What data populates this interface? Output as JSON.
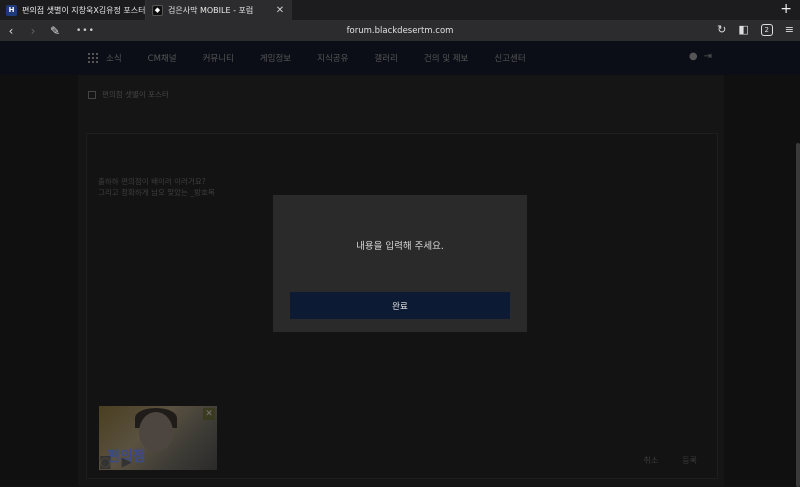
{
  "browser": {
    "tabs": [
      {
        "favicon": "H",
        "title": "편의점 샛별이 지창욱X김유정 포스터",
        "active": false
      },
      {
        "favicon": "◆",
        "title": "검은사막 MOBILE - 포럼",
        "active": true
      }
    ],
    "new_tab": "+",
    "close": "✕",
    "address": "forum.blackdesertm.com",
    "tab_count": "2"
  },
  "site_nav": {
    "menu": [
      "소식",
      "CM채널",
      "커뮤니티",
      "게임정보",
      "지식공유",
      "갤러리",
      "건의 및 제보",
      "신고센터"
    ]
  },
  "content": {
    "draft_label": "편의점 샛별이 포스터",
    "editor_lines": [
      "출하하 편의점이 배이러 이러거요?",
      "그리고 정확하게 남오 맞았는 _방호복"
    ],
    "thumb_text": "편의점",
    "cancel": "취소",
    "submit": "등록"
  },
  "modal": {
    "message": "내용을 입력해 주세요.",
    "confirm": "완료"
  },
  "colors": {
    "modal_button": "#0d1a33",
    "modal_bg": "#2a2a2a"
  }
}
